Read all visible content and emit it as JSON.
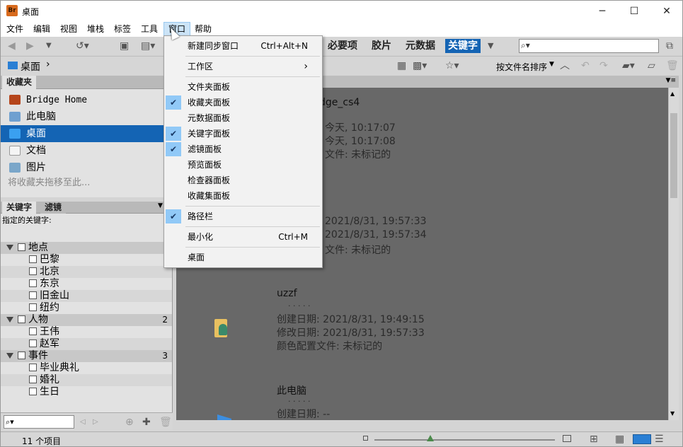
{
  "window": {
    "app_badge": "Br",
    "title": "桌面",
    "minimize": "─",
    "maximize": "☐",
    "close": "✕"
  },
  "menubar": [
    "文件",
    "编辑",
    "视图",
    "堆栈",
    "标签",
    "工具",
    "窗口",
    "帮助"
  ],
  "workspace_tabs": {
    "essentials": "必要项",
    "filmstrip": "胶片",
    "metadata": "元数据",
    "keywords": "关键字"
  },
  "search": {
    "prefix": "⌕▾"
  },
  "pathbar": {
    "location": "桌面",
    "sort_label": "按文件名排序"
  },
  "favorites": {
    "tab_label": "收藏夹",
    "items": [
      "Bridge Home",
      "此电脑",
      "桌面",
      "文档",
      "图片"
    ],
    "drop_hint": "将收藏夹拖移至此..."
  },
  "keywords": {
    "tab_keywords": "关键字",
    "tab_filter": "滤镜",
    "assigned_label": "指定的关键字:",
    "categories": [
      {
        "name": "地点",
        "count": "",
        "items": [
          "巴黎",
          "北京",
          "东京",
          "旧金山",
          "纽约"
        ]
      },
      {
        "name": "人物",
        "count": "2",
        "items": [
          "王伟",
          "赵军"
        ]
      },
      {
        "name": "事件",
        "count": "3",
        "items": [
          "毕业典礼",
          "婚礼",
          "生日"
        ]
      }
    ]
  },
  "content": {
    "entries": [
      {
        "name": "dge_cs4",
        "dots": "",
        "lines": [
          "今天, 10:17:07",
          "今天, 10:17:08",
          "文件: 未标记的"
        ]
      },
      {
        "name": "",
        "dots": "",
        "lines": [
          "2021/8/31, 19:57:33",
          "2021/8/31, 19:57:34",
          "文件: 未标记的"
        ]
      },
      {
        "name": "uzzf",
        "dots": ". . . . .",
        "lines": [
          "创建日期: 2021/8/31, 19:49:15",
          "修改日期: 2021/8/31, 19:57:33",
          "颜色配置文件: 未标记的"
        ]
      },
      {
        "name": "此电脑",
        "dots": ". . . . .",
        "lines": [
          "创建日期: --"
        ]
      }
    ]
  },
  "status": {
    "count_text": "11 个项目"
  },
  "window_menu": {
    "items": [
      {
        "label": "新建同步窗口",
        "shortcut": "Ctrl+Alt+N",
        "checked": false
      },
      {
        "label": "工作区",
        "shortcut": "›",
        "checked": false
      },
      {
        "label": "文件夹面板",
        "shortcut": "",
        "checked": false
      },
      {
        "label": "收藏夹面板",
        "shortcut": "",
        "checked": true
      },
      {
        "label": "元数据面板",
        "shortcut": "",
        "checked": false
      },
      {
        "label": "关键字面板",
        "shortcut": "",
        "checked": true
      },
      {
        "label": "滤镜面板",
        "shortcut": "",
        "checked": true
      },
      {
        "label": "预览面板",
        "shortcut": "",
        "checked": false
      },
      {
        "label": "检查器面板",
        "shortcut": "",
        "checked": false
      },
      {
        "label": "收藏集面板",
        "shortcut": "",
        "checked": false
      },
      {
        "label": "路径栏",
        "shortcut": "",
        "checked": true
      },
      {
        "label": "最小化",
        "shortcut": "Ctrl+M",
        "checked": false
      },
      {
        "label": "桌面",
        "shortcut": "",
        "checked": false
      }
    ]
  },
  "colors": {
    "accent": "#1464b4",
    "check_bg": "#91c9f7",
    "content_bg": "#686868"
  }
}
